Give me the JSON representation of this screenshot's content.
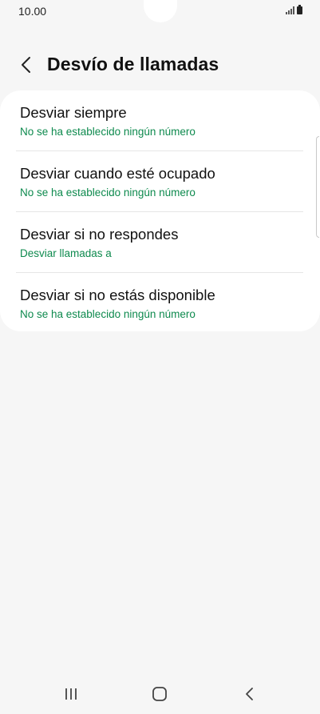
{
  "status_bar": {
    "time": "10.00"
  },
  "header": {
    "title": "Desvío de llamadas"
  },
  "items": [
    {
      "title": "Desviar siempre",
      "subtitle": "No se ha establecido ningún número"
    },
    {
      "title": "Desviar cuando esté ocupado",
      "subtitle": "No se ha establecido ningún número"
    },
    {
      "title": "Desviar si no respondes",
      "subtitle": "Desviar llamadas a"
    },
    {
      "title": "Desviar si no estás disponible",
      "subtitle": "No se ha establecido ningún número"
    }
  ],
  "icons": {
    "back": "chevron-left-icon",
    "signal": "signal-icon",
    "battery": "battery-icon",
    "recents": "recent-apps-icon",
    "home": "home-icon",
    "nav_back": "back-icon"
  },
  "colors": {
    "accent": "#0e8a4e",
    "background": "#f6f6f6",
    "card": "#ffffff"
  }
}
